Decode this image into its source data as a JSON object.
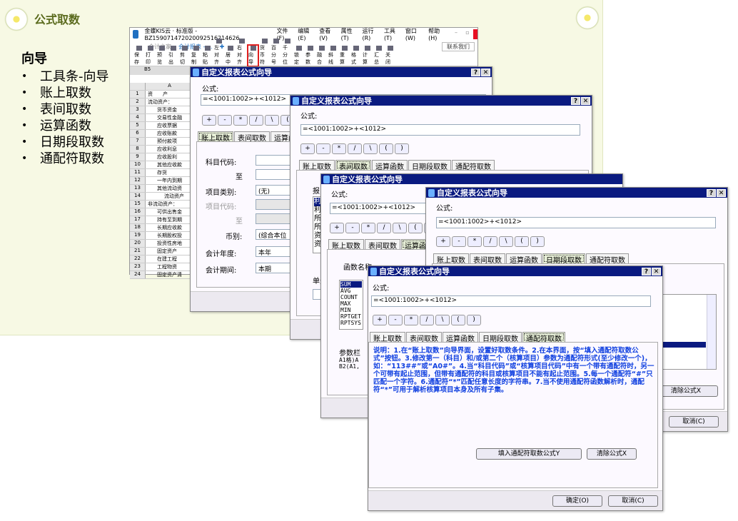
{
  "slide": {
    "title": "公式取数",
    "guide_heading": "向导",
    "guide_items": [
      "工具条-向导",
      "账上取数",
      "表间取数",
      "运算函数",
      "日期段取数",
      "通配符取数"
    ]
  },
  "app": {
    "title": "金蝶KIS云 · 标准版 - BZ15907147202009251621462­6",
    "menu": [
      "文件(F)",
      "编辑(E)",
      "查看(V)",
      "属性(T)",
      "运行(R)",
      "工具(T)",
      "窗口(W)",
      "帮助(H)"
    ],
    "tabs": [
      "会计之家",
      "会计报表 - ..."
    ],
    "contact": "联系我们",
    "toolbar": [
      "保存",
      "打印",
      "预览",
      "引出",
      "剪切",
      "复制",
      "粘贴",
      "左对齐",
      "居中",
      "右对齐",
      "向导",
      "货币符",
      "百分号",
      "千分位",
      "锁定",
      "参数",
      "融合",
      "斜线",
      "重算",
      "格式",
      "计算",
      "汇总",
      "关闭"
    ],
    "cell_ref": "B5",
    "column": "A",
    "rows": [
      "资　　产",
      "流动资产：",
      "货币资金",
      "交易性金融",
      "应收票据",
      "应收账款",
      "预付款项",
      "应收利息",
      "应收股利",
      "其他应收款",
      "存货",
      "一年内到期",
      "其他流动资",
      "流动资产",
      "非流动资产：",
      "可供出售金",
      "持有至到期",
      "长期应收款",
      "长期股权投",
      "投资性房地",
      "固定资产",
      "在建工程",
      "工程物资",
      "固定资产清"
    ]
  },
  "dialog": {
    "title": "自定义报表公式向导",
    "help": "?",
    "close": "✕",
    "formula_label": "公式:",
    "formula_value": "=<1001:1002>+<1012>",
    "ops": [
      "+",
      "-",
      "*",
      "/",
      "\\",
      "(",
      ")"
    ],
    "tabs": [
      "账上取数",
      "表间取数",
      "运算函数",
      "日期段取数",
      "通配符取数"
    ]
  },
  "ledger": {
    "account_code": "科目代码:",
    "to": "至",
    "item_category": "项目类别:",
    "item_category_value": "(无)",
    "item_code": "项目代码:",
    "currency": "币别:",
    "currency_value": "(综合本位",
    "year": "会计年度:",
    "year_value": "本年",
    "period": "会计期间:",
    "period_value": "本期"
  },
  "between": {
    "report_label": "报",
    "report_items": [
      "利",
      "利",
      "所",
      "所",
      "资",
      "资"
    ],
    "cell_label": "单元"
  },
  "functions": {
    "label": "函数名称",
    "items": [
      "SUM",
      "AVG",
      "COUNT",
      "MAX",
      "MIN",
      "RPTGET",
      "RPTSYS"
    ],
    "param_label": "参数栏",
    "param_lines": [
      "A1格)A",
      "B2(A1,"
    ]
  },
  "date_range": {
    "clear": "清除公式X",
    "cancel": "取消(C)"
  },
  "wildcard": {
    "description": "说明：1.在“账上取数”向导界面，设置好取数条件。2.在本界面，按“填入通配符取数公式”按钮。3.修改第一（科目）和/或第二个（核算项目）参数为通配符形式(至少修改一个)，如：“113##”或“A0#”。4.当“科目代码”或“核算项目代码”中有一个带有通配符时，另一个可带有起止范围，但带有通配符的科目或核算项目不能有起止范围。5.每一个通配符“#”只匹配一个字符。6.通配符“*”匹配任意长度的字符串。7.当不使用通配符函数解析时，通配符“*”可用于解析核算项目本身及所有子集。",
    "fill": "填入通配符取数公式Y",
    "clear": "清除公式X",
    "ok": "确定(O)",
    "cancel": "取消(C)"
  }
}
